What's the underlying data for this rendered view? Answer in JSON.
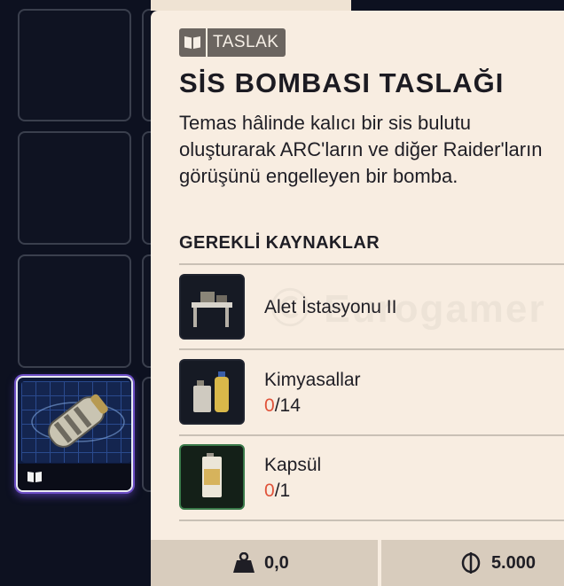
{
  "tooltip": {
    "badge": {
      "label": "TASLAK",
      "icon": "open-book-icon"
    },
    "title": "SİS BOMBASI TASLAĞI",
    "description": "Temas hâlinde kalıcı bir sis bulutu oluşturarak ARC'ların ve diğer Raider'ların görüşünü engelleyen bir bomba.",
    "requirements_heading": "GEREKLİ KAYNAKLAR",
    "requirements": [
      {
        "name": "Alet İstasyonu II",
        "icon": "workbench-icon"
      },
      {
        "name": "Kimyasallar",
        "have": "0",
        "need": "/14",
        "icon": "chemical-bottles-icon"
      },
      {
        "name": "Kapsül",
        "have": "0",
        "need": "/1",
        "icon": "canister-icon"
      }
    ],
    "footer": {
      "weight": "0,0",
      "weight_icon": "weight-icon",
      "price": "5.000",
      "price_icon": "coin-icon"
    }
  },
  "inventory": {
    "selected_item": "smoke-grenade-icon",
    "selected_badge_icon": "open-book-icon"
  },
  "colors": {
    "panel_bg": "#f8ede1",
    "badge_bg": "#6b6560",
    "quantity_have": "#e0533a",
    "app_bg": "#0d1120"
  }
}
